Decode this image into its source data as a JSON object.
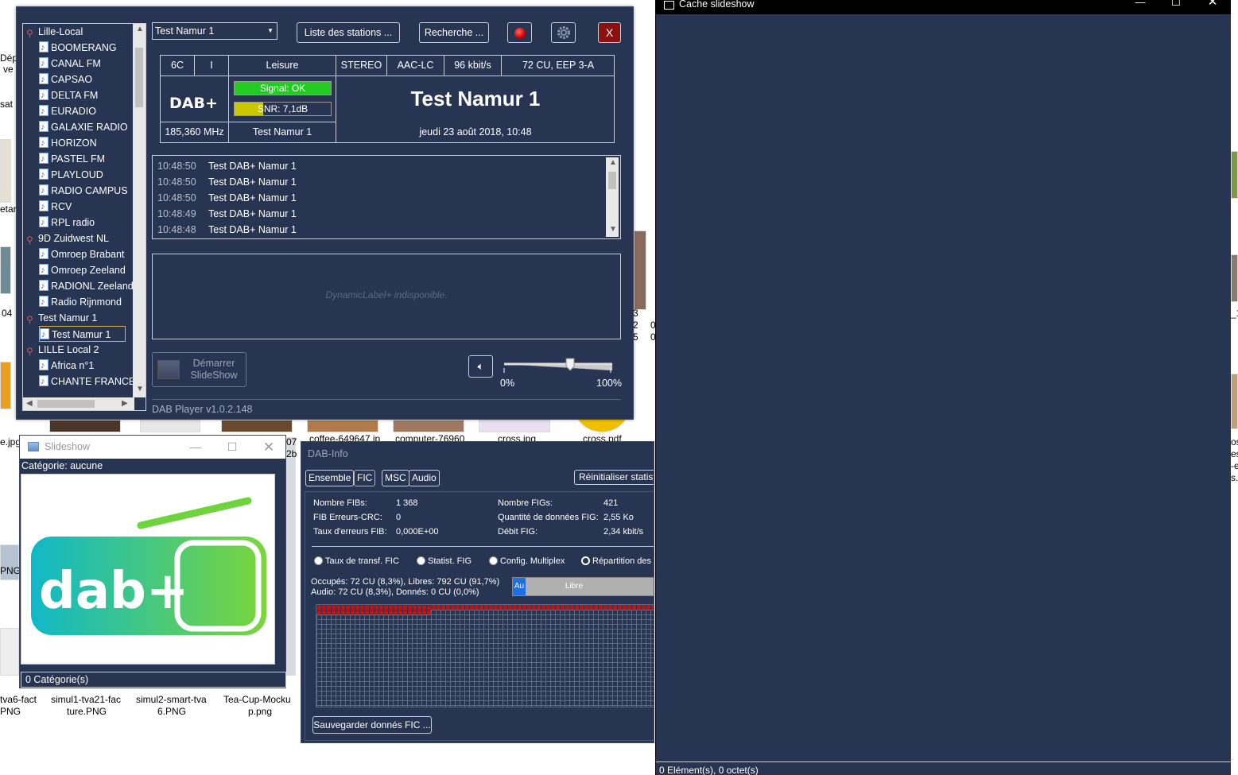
{
  "desktop": {
    "labels": [
      "Dép",
      "ve",
      "sat",
      "etar",
      "04",
      "e.jpg",
      "PNG",
      "07",
      "2b",
      "coffee-649647.jp",
      "computer-76960",
      "cross.jpg",
      "cross.pdf",
      "3",
      "2",
      "5",
      "0",
      "0",
      "_1",
      "os",
      "es",
      "-e",
      "s.",
      "tva6-fact",
      "PNG",
      "simul1-tva21-fac",
      "ture.PNG",
      "simul2-smart-tva",
      "6.PNG",
      "Tea-Cup-Mocku",
      "p.png"
    ]
  },
  "main": {
    "tree": [
      {
        "type": "ensemble",
        "label": "Lille-Local"
      },
      {
        "type": "service",
        "label": "BOOMERANG"
      },
      {
        "type": "service",
        "label": "CANAL FM"
      },
      {
        "type": "service",
        "label": "CAPSAO"
      },
      {
        "type": "service",
        "label": "DELTA FM"
      },
      {
        "type": "service",
        "label": "EURADIO"
      },
      {
        "type": "service",
        "label": "GALAXIE RADIO"
      },
      {
        "type": "service",
        "label": "HORIZON"
      },
      {
        "type": "service",
        "label": "PASTEL FM"
      },
      {
        "type": "service",
        "label": "PLAYLOUD"
      },
      {
        "type": "service",
        "label": "RADIO CAMPUS"
      },
      {
        "type": "service",
        "label": "RCV"
      },
      {
        "type": "service",
        "label": "RPL radio"
      },
      {
        "type": "ensemble",
        "label": "9D Zuidwest NL"
      },
      {
        "type": "service",
        "label": "Omroep Brabant"
      },
      {
        "type": "service",
        "label": "Omroep Zeeland"
      },
      {
        "type": "service",
        "label": "RADIONL Zeeland"
      },
      {
        "type": "service",
        "label": "Radio Rijnmond"
      },
      {
        "type": "ensemble",
        "label": "Test Namur 1"
      },
      {
        "type": "service",
        "label": "Test Namur 1",
        "selected": true
      },
      {
        "type": "ensemble",
        "label": "LILLE Local 2"
      },
      {
        "type": "service",
        "label": "Africa n°1"
      },
      {
        "type": "service",
        "label": "CHANTE FRANCE"
      }
    ],
    "combo_value": "Test Namur 1",
    "btn_stations": "Liste des stations ...",
    "btn_search": "Recherche ...",
    "btn_close": "X",
    "info": {
      "channel": "6C",
      "mode": "I",
      "genre": "Leisure",
      "stereo": "STEREO",
      "codec": "AAC-LC",
      "bitrate": "96 kbit/s",
      "cu": "72 CU, EEP 3-A",
      "logo_text": "DAB+",
      "signal": "Signal: OK",
      "snr": "SNR: 7,1dB",
      "snr_level": 0.3,
      "station_name": "Test Namur 1",
      "frequency": "185,360 MHz",
      "ensemble": "Test Namur 1",
      "datetime": "jeudi 23 août 2018, 10:48"
    },
    "log": [
      {
        "time": "10:48:50",
        "text": "Test DAB+ Namur 1"
      },
      {
        "time": "10:48:50",
        "text": "Test DAB+ Namur 1"
      },
      {
        "time": "10:48:50",
        "text": "Test DAB+ Namur 1"
      },
      {
        "time": "10:48:49",
        "text": "Test DAB+ Namur 1"
      },
      {
        "time": "10:48:48",
        "text": "Test DAB+ Namur 1"
      }
    ],
    "dynamic_label": "DynamicLabel+ indisponible.",
    "btn_slideshow_line1": "Démarrer",
    "btn_slideshow_line2": "SlideShow",
    "volume_level": 0.62,
    "vol_min": "0%",
    "vol_max": "100%",
    "version": "DAB Player v1.0.2.148"
  },
  "slideshow": {
    "title": "Slideshow",
    "category": "Catégorie: aucune",
    "status": "0 Catégorie(s)",
    "logo_text": "dab+"
  },
  "dabinfo": {
    "title": "DAB-Info",
    "tabs": [
      "Ensemble",
      "FIC",
      "MSC",
      "Audio"
    ],
    "active_tab": "FIC",
    "reset_label": "Réinitialiser statistiques",
    "stats": {
      "fibs_label": "Nombre FIBs:",
      "fibs_value": "1 368",
      "crc_label": "FIB Erreurs-CRC:",
      "crc_value": "0",
      "err_label": "Taux d'erreurs FIB:",
      "err_value": "0,000E+00",
      "figs_label": "Nombre FIGs:",
      "figs_value": "421",
      "qty_label": "Quantité de données FIG:",
      "qty_value": "2,55 Ko",
      "rate_label": "Débit FIG:",
      "rate_value": "2,34 kbit/s"
    },
    "radios": [
      "Taux de transf. FIC",
      "Statist. FIG",
      "Config. Multiplex",
      "Répartition des CU"
    ],
    "radio_selected": 3,
    "occupancy_line1": "Occupés: 72 CU (8,3%), Libres: 792 CU (91,7%)",
    "occupancy_line2": "Audio: 72 CU (8,3%), Donnés: 0 CU (0,0%)",
    "bar_audio": "Au",
    "bar_free": "Libre",
    "audio_fraction": 0.083,
    "save_label": "Sauvegarder donnés FIC ..."
  },
  "cache": {
    "title": "Cache slideshow",
    "status": "0 Elément(s), 0 octet(s)"
  }
}
